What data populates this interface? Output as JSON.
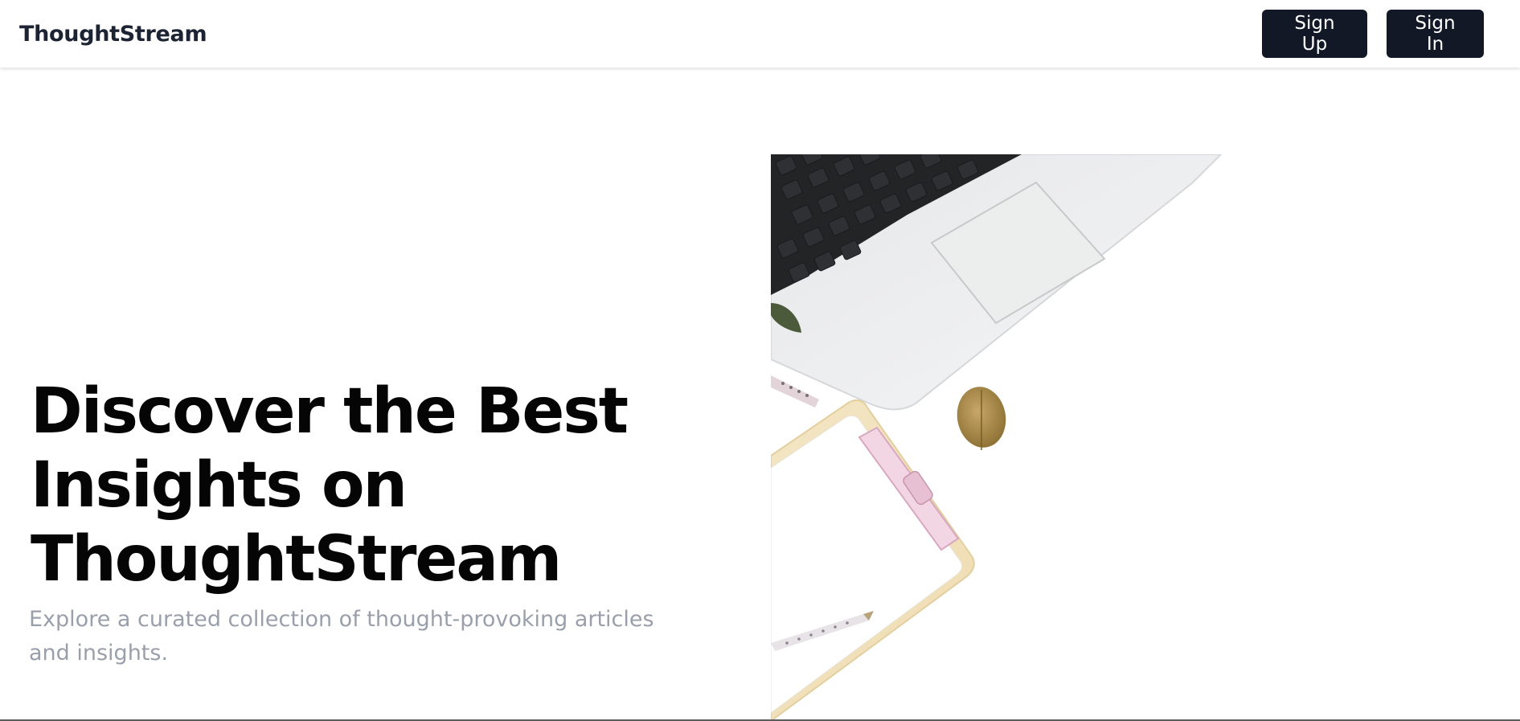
{
  "navbar": {
    "brand": "ThoughtStream",
    "signup_label": "Sign Up",
    "signin_label": "Sign In"
  },
  "hero": {
    "title_line1": "Discover the Best",
    "title_line2": "Insights on",
    "title_line3": "ThoughtStream",
    "subtitle": "Explore a curated collection of thought-provoking articles and insights.",
    "image_icon": "workspace-photo-icon"
  },
  "colors": {
    "button_bg": "#121826",
    "brand_text": "#1c2333",
    "subtitle_text": "#9aa0ab"
  }
}
